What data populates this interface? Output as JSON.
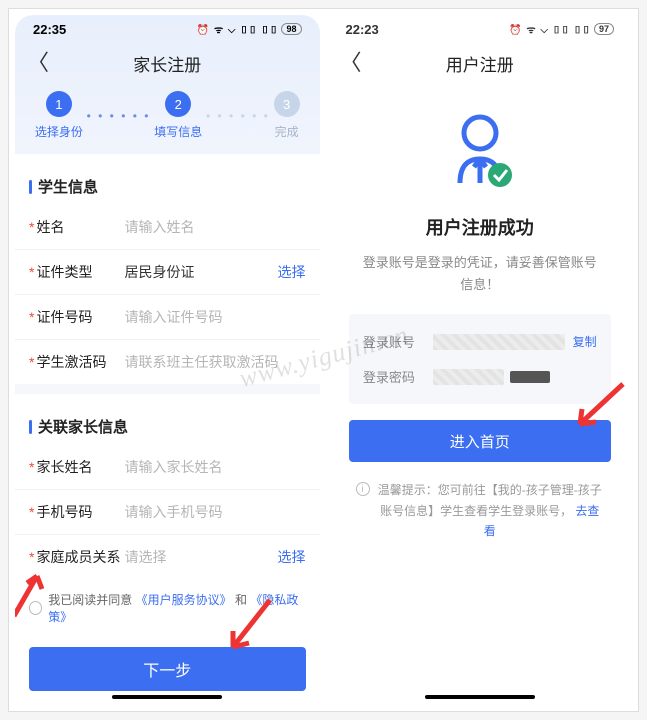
{
  "watermark": "www.yigujin.cn",
  "left": {
    "status": {
      "time": "22:35",
      "battery": "98"
    },
    "nav_title": "家长注册",
    "steps": [
      {
        "num": "1",
        "label": "选择身份",
        "state": "done"
      },
      {
        "num": "2",
        "label": "填写信息",
        "state": "done"
      },
      {
        "num": "3",
        "label": "完成",
        "state": "todo"
      }
    ],
    "section1_title": "学生信息",
    "fields1": {
      "name_label": "姓名",
      "name_ph": "请输入姓名",
      "idtype_label": "证件类型",
      "idtype_value": "居民身份证",
      "idtype_action": "选择",
      "idno_label": "证件号码",
      "idno_ph": "请输入证件号码",
      "code_label": "学生激活码",
      "code_ph": "请联系班主任获取激活码"
    },
    "section2_title": "关联家长信息",
    "fields2": {
      "pname_label": "家长姓名",
      "pname_ph": "请输入家长姓名",
      "phone_label": "手机号码",
      "phone_ph": "请输入手机号码",
      "rel_label": "家庭成员关系",
      "rel_ph": "请选择",
      "rel_action": "选择"
    },
    "agree": {
      "prefix": "我已阅读并同意",
      "link1": "《用户服务协议》",
      "mid": "和",
      "link2": "《隐私政策》"
    },
    "submit": "下一步"
  },
  "right": {
    "status": {
      "time": "22:23",
      "battery": "97"
    },
    "nav_title": "用户注册",
    "title": "用户注册成功",
    "subtitle": "登录账号是登录的凭证，请妥善保管账号信息！",
    "cred_account_label": "登录账号",
    "cred_password_label": "登录密码",
    "copy": "复制",
    "enter_btn": "进入首页",
    "tip_text": "温馨提示：您可前往【我的-孩子管理-孩子账号信息】学生查看学生登录账号，",
    "tip_link": "去查看"
  }
}
